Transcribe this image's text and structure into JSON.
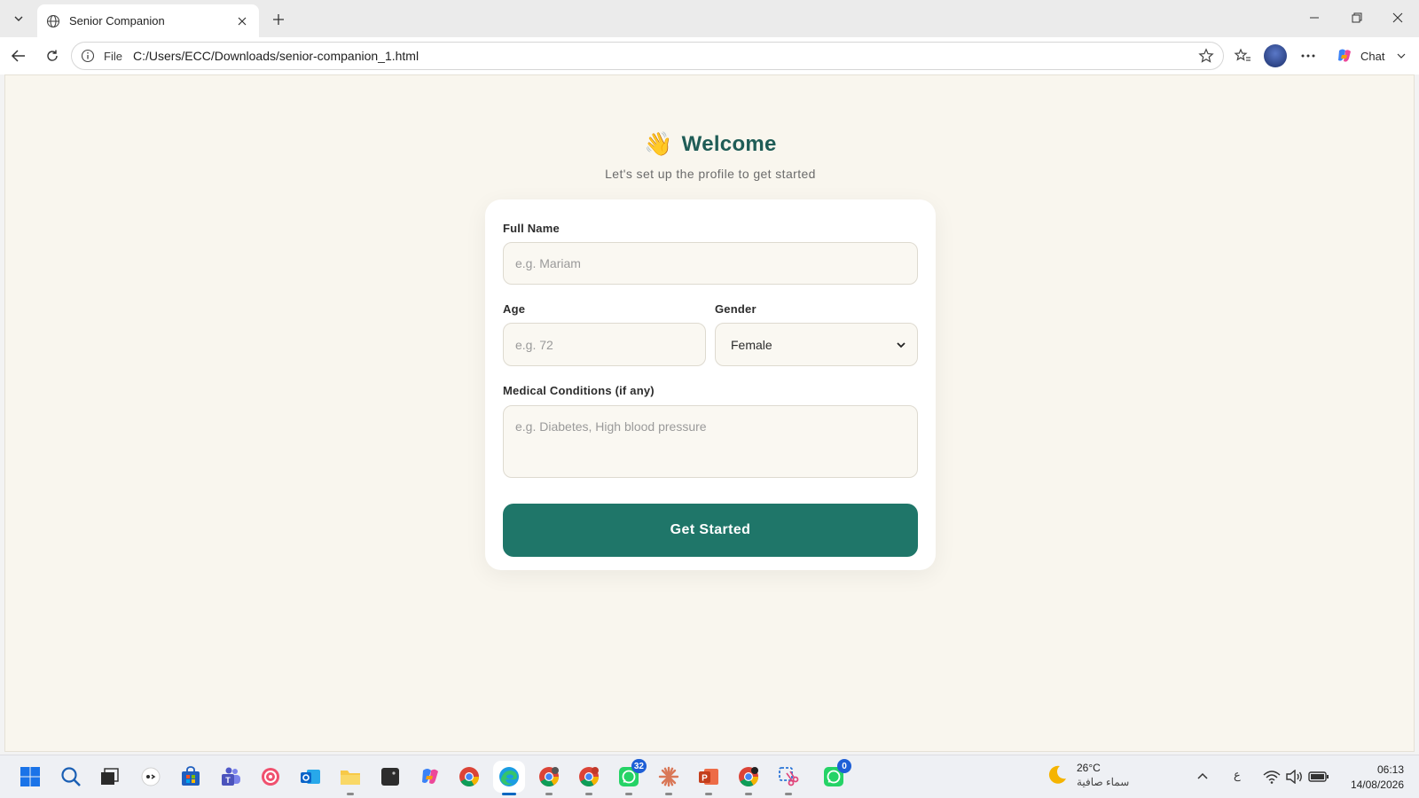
{
  "browser": {
    "tab_title": "Senior Companion",
    "address_scheme": "File",
    "address_url": "C:/Users/ECC/Downloads/senior-companion_1.html",
    "chat_label": "Chat"
  },
  "page": {
    "wave_emoji": "👋",
    "title": "Welcome",
    "subtitle": "Let's set up the profile to get started",
    "form": {
      "full_name_label": "Full Name",
      "full_name_placeholder": "e.g. Mariam",
      "age_label": "Age",
      "age_placeholder": "e.g. 72",
      "gender_label": "Gender",
      "gender_value": "Female",
      "medical_label": "Medical Conditions (if any)",
      "medical_placeholder": "e.g. Diabetes, High blood pressure",
      "submit_label": "Get Started"
    },
    "colors": {
      "accent": "#1f7669",
      "title": "#1f5c56",
      "background": "#f9f6ee"
    }
  },
  "taskbar": {
    "whatsapp_badge": "32",
    "whatsapp_business_badge": "0",
    "weather_temp": "26°C",
    "weather_desc": "سماء صافية",
    "input_lang": "ع",
    "time": "06:13",
    "date": "14/08/2026"
  }
}
